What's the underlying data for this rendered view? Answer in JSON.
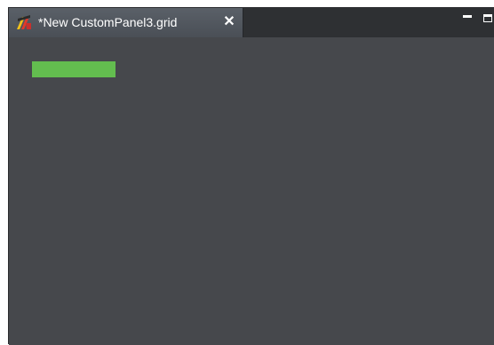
{
  "tab": {
    "title": "*New CustomPanel3.grid",
    "close_glyph": "✕",
    "icon": "app-logo-icon"
  },
  "window_controls": {
    "minimize": "minimize-icon",
    "maximize": "maximize-icon"
  },
  "colors": {
    "canvas_bg": "#46484c",
    "tab_bg": "#52575e",
    "grid_cell": "#63bd4f"
  }
}
